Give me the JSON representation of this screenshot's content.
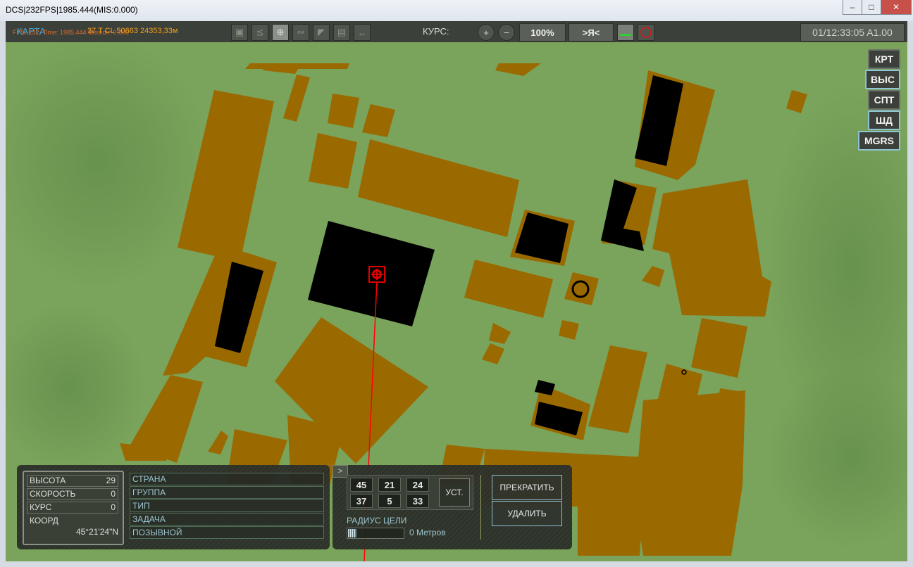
{
  "window": {
    "title": "DCS|232FPS|1985.444(MIS:0.000)"
  },
  "toolbar": {
    "map_label": "КАРТА",
    "fps_overlay": "FPS: 232, Time: 1985.444 Mission: 0.000",
    "coords_readout": "37 T CL 50663 24353,33м",
    "course_label": "КУРС:",
    "zoom_value": "100%",
    "center_me_label": ">Я<",
    "time_display": "01/12:33:05 A1.00"
  },
  "right_buttons": [
    "КРТ",
    "ВЫС",
    "СПТ",
    "ШД",
    "MGRS"
  ],
  "info": {
    "altitude_label": "ВЫСОТА",
    "altitude_value": "29",
    "speed_label": "СКОРОСТЬ",
    "speed_value": "0",
    "course_label": "КУРС",
    "course_value": "0",
    "coord_label": "КООРД",
    "coord_value": "45°21'24\"N"
  },
  "fields": [
    "СТРАНА",
    "ГРУППА",
    "ТИП",
    "ЗАДАЧА",
    "ПОЗЫВНОЙ"
  ],
  "target": {
    "collapse_label": ">",
    "row1": [
      "45",
      "21",
      "24"
    ],
    "row2": [
      "37",
      "5",
      "33"
    ],
    "set_button": "УСТ.",
    "radius_label": "РАДИУС ЦЕЛИ",
    "radius_value": "0 Метров",
    "stop_button": "ПРЕКРАТИТЬ",
    "delete_button": "УДАЛИТЬ"
  },
  "colors": {
    "terrain": "#7aa35b",
    "building": "#9a6a00",
    "roof": "#000000",
    "marker": "#e00000"
  }
}
